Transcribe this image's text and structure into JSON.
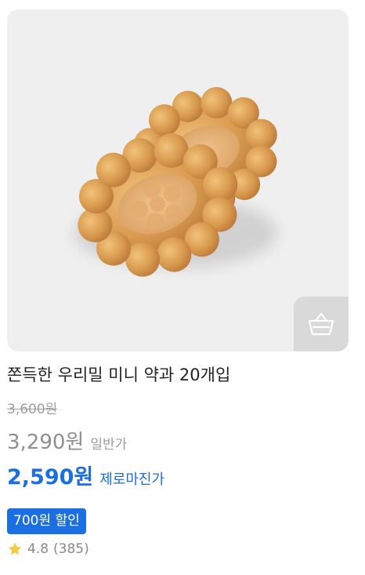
{
  "product": {
    "image_alt": "쫀득한 우리밀 미니 약과",
    "title": "쫀득한 우리밀 미니 약과 20개입",
    "original_price": "3,600원",
    "regular_price": "3,290원",
    "regular_price_tag": "일반가",
    "zero_margin_price": "2,590원",
    "zero_margin_tag": "제로마진가",
    "discount_badge": "700원 할인",
    "rating": "4.8",
    "review_count": "(385)"
  },
  "colors": {
    "accent": "#1b6fe0",
    "star": "#f7c948",
    "image_background": "#f0efef",
    "cart_button": "#d9d9d9"
  },
  "icons": {
    "cart": "shopping-basket-icon",
    "rating": "star-icon"
  }
}
